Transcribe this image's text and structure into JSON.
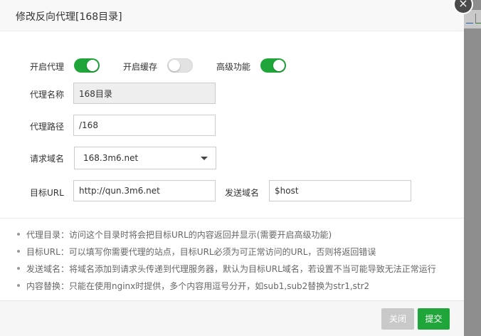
{
  "dialog": {
    "title": "修改反向代理[168目录]",
    "close_glyph": "×"
  },
  "toggles": {
    "proxy_enabled": {
      "label": "开启代理",
      "state": "on"
    },
    "cache_enabled": {
      "label": "开启缓存",
      "state": "off"
    },
    "advanced_enabled": {
      "label": "高级功能",
      "state": "on"
    }
  },
  "form": {
    "proxy_name": {
      "label": "代理名称",
      "value": "168目录"
    },
    "proxy_path": {
      "label": "代理路径",
      "value": "/168"
    },
    "request_domain": {
      "label": "请求域名",
      "value": "168.3m6.net"
    },
    "target_url": {
      "label": "目标URL",
      "value": "http://qun.3m6.net"
    },
    "send_domain": {
      "label": "发送域名",
      "value": "$host"
    }
  },
  "notes": [
    "代理目录：访问这个目录时将会把目标URL的内容返回并显示(需要开启高级功能)",
    "目标URL：可以填写你需要代理的站点，目标URL必须为可正常访问的URL，否则将返回错误",
    "发送域名：将域名添加到请求头传递到代理服务器，默认为目标URL域名，若设置不当可能导致无法正常运行",
    "内容替换：只能在使用nginx时提供，多个内容用逗号分开，如sub1,sub2替换为str1,str2"
  ],
  "footer": {
    "cancel_label": "关闭",
    "submit_label": "提交"
  },
  "colors": {
    "accent": "#20a53a",
    "toggle_off": "#e2e2e2",
    "button_disabled": "#c9c9c9"
  }
}
